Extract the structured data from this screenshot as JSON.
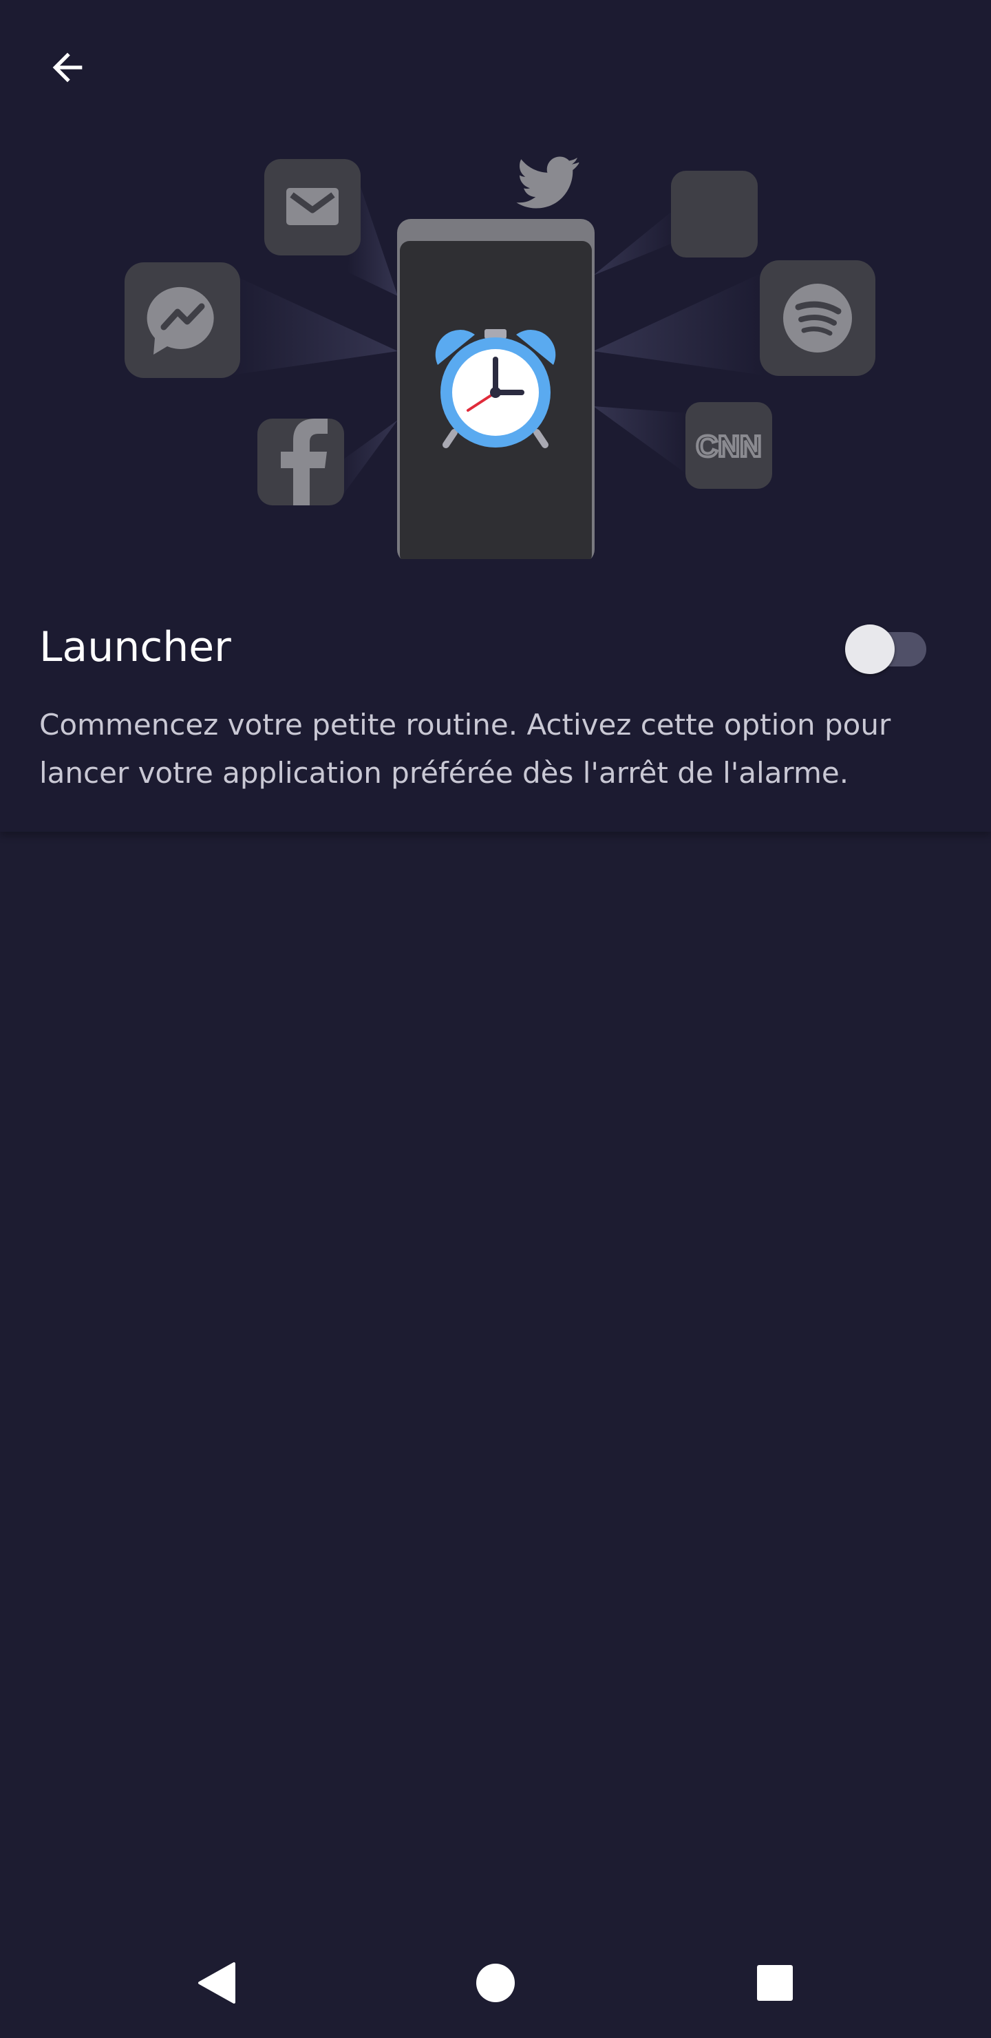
{
  "header": {
    "back_icon": "arrow-left-icon"
  },
  "illustration": {
    "center_icon": "alarm-clock-icon",
    "apps": [
      "mail-icon",
      "messenger-icon",
      "facebook-icon",
      "twitter-icon",
      "spotify-icon",
      "cnn-icon"
    ],
    "cnn_text": "CNN"
  },
  "setting": {
    "title": "Launcher",
    "description": "Commencez votre petite routine. Activez cette option pour lancer votre application préférée dès l'arrêt de l'alarme.",
    "enabled": false
  },
  "colors": {
    "background": "#1c1b31",
    "tile": "#3f3f46",
    "clock_blue": "#5aaaf0"
  },
  "navbar": {
    "icons": [
      "back-triangle-icon",
      "home-circle-icon",
      "recents-square-icon"
    ]
  }
}
